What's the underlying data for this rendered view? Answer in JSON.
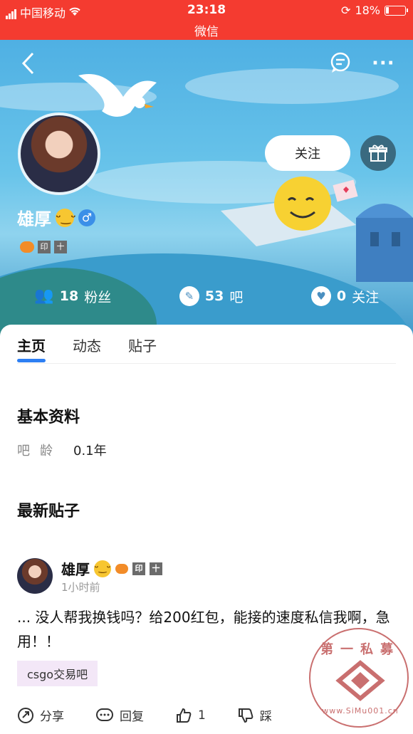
{
  "status_bar": {
    "carrier": "中国移动",
    "time": "23:18",
    "battery": "18%",
    "subtitle": "微信"
  },
  "profile": {
    "follow_button": "关注",
    "username": "雄厚",
    "badges": [
      "印",
      "十"
    ]
  },
  "stats": [
    {
      "value": "18",
      "label": "粉丝"
    },
    {
      "value": "53",
      "label": "吧"
    },
    {
      "value": "0",
      "label": "关注"
    }
  ],
  "tabs": [
    "主页",
    "动态",
    "贴子"
  ],
  "basic_info": {
    "title": "基本资料",
    "age_label": "吧龄",
    "age_value": "0.1年"
  },
  "latest_posts": {
    "title": "最新贴子"
  },
  "post": {
    "author": "雄厚",
    "time": "1小时前",
    "body": "... 没人帮我换钱吗？给200红包，能接的速度私信我啊，急用！！",
    "tag": "csgo交易吧",
    "actions": {
      "share": "分享",
      "reply": "回复",
      "like_count": "1",
      "dislike": "踩"
    }
  },
  "watermark": {
    "text": "第一私募",
    "url": "www.SiMu001.cn"
  }
}
